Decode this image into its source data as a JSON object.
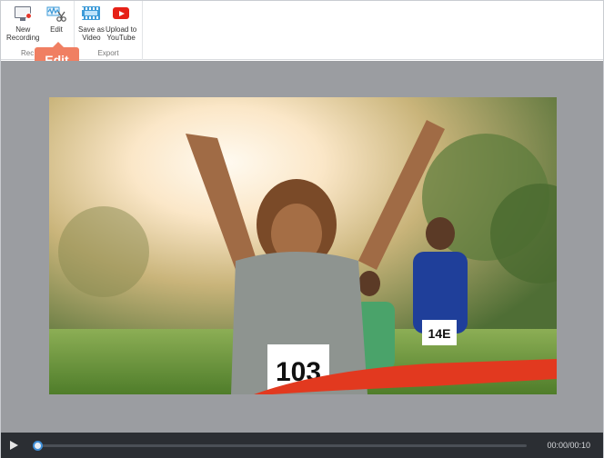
{
  "ribbon": {
    "record_group": {
      "label": "Rec",
      "buttons": [
        {
          "id": "new-recording",
          "label_line1": "New",
          "label_line2": "Recording",
          "icon": "monitor-record-icon"
        },
        {
          "id": "edit",
          "label_line1": "Edit",
          "label_line2": "",
          "icon": "edit-waveform-icon"
        }
      ]
    },
    "export_group": {
      "label": "Export",
      "buttons": [
        {
          "id": "save-as-video",
          "label_line1": "Save as",
          "label_line2": "Video",
          "icon": "film-icon"
        },
        {
          "id": "upload-youtube",
          "label_line1": "Upload to",
          "label_line2": "YouTube",
          "icon": "youtube-icon"
        }
      ]
    }
  },
  "tooltip": {
    "text": "Edit"
  },
  "preview": {
    "bib_number_main": "103",
    "bib_number_secondary": "14E"
  },
  "player": {
    "time": "00:00/00:10",
    "progress": 0.0
  },
  "colors": {
    "tooltip": "#f07f62",
    "workspace": "#9b9da1",
    "player_bar": "#2b2e33",
    "progress_knob": "#3f8ed6",
    "record_dot": "#e5372c",
    "youtube": "#e62117",
    "film": "#3e9bd8"
  }
}
